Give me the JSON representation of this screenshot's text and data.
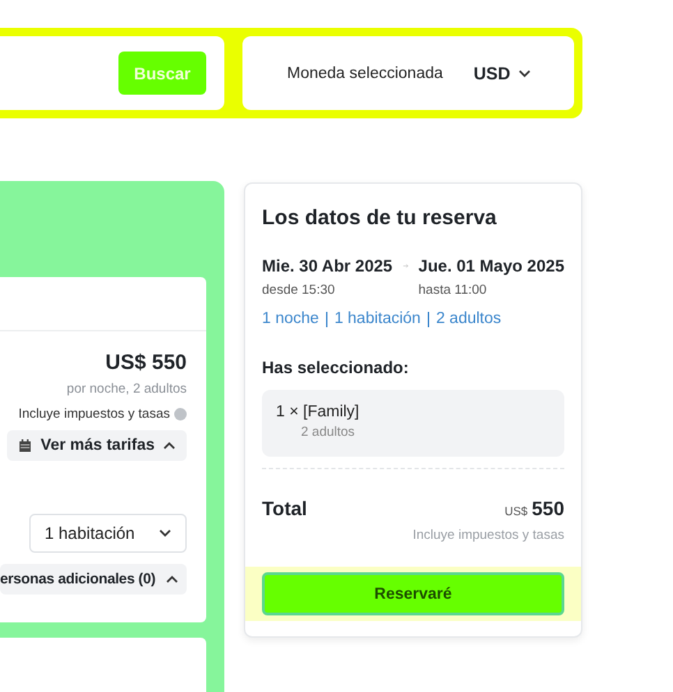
{
  "search_bar": {
    "search_button": "Buscar",
    "currency_label": "Moneda seleccionada",
    "currency": "USD"
  },
  "room_offer": {
    "price": "US$ 550",
    "price_note": "por noche, 2 adultos",
    "taxes_note": "Incluye impuestos y tasas",
    "more_rates_button": {
      "label": "Ver más tarifas",
      "expanded": true
    },
    "rooms_select": {
      "value": "1 habitación"
    },
    "extra_people_button": {
      "label": "ersonas adicionales (0)",
      "expanded": true
    }
  },
  "booking_summary": {
    "title": "Los datos de tu reserva",
    "check_in": {
      "date": "Mie. 30 Abr 2025",
      "time": "desde 15:30"
    },
    "check_out": {
      "date": "Jue. 01 Mayo 2025",
      "time": "hasta 11:00"
    },
    "stay_links": [
      "1 noche",
      "1 habitación",
      "2 adultos"
    ],
    "selection_heading": "Has seleccionado:",
    "selection": {
      "room": "1 × [Family]",
      "guests": "2 adultos"
    },
    "total_label": "Total",
    "total_currency": "US$",
    "total_amount": "550",
    "total_note": "Incluye impuestos y tasas",
    "book_button": "Reservaré"
  }
}
